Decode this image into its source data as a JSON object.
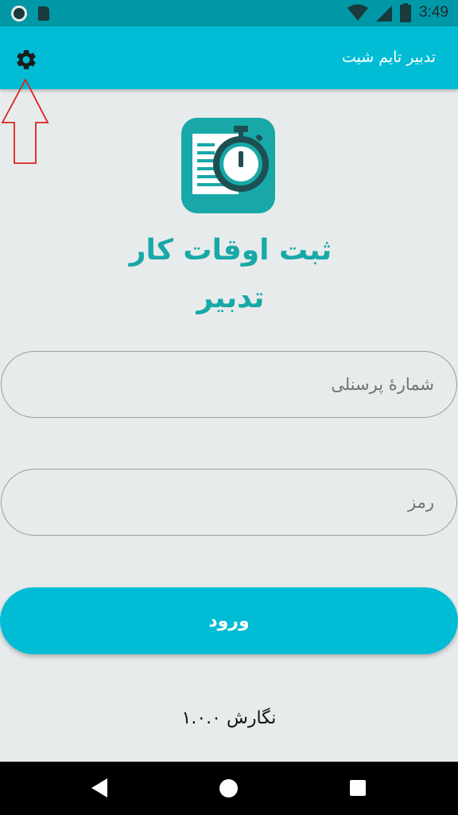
{
  "status_bar": {
    "time": "3:49"
  },
  "app_bar": {
    "title": "تدبیر تایم شیت",
    "settings_icon": "gear-icon"
  },
  "brand": {
    "logo_icon": "document-stopwatch-icon",
    "name": "ثبت اوقات کار تدبیر"
  },
  "form": {
    "personnel_placeholder": "شمارۀ پرسنلی",
    "password_placeholder": "رمز",
    "login_label": "ورود"
  },
  "footer": {
    "version": "نگارش ۱.۰.۰"
  },
  "colors": {
    "primary": "#00bcd4",
    "primary_dark": "#0097a7",
    "background": "#e8ebeb",
    "logo_teal": "#18a8a8"
  }
}
